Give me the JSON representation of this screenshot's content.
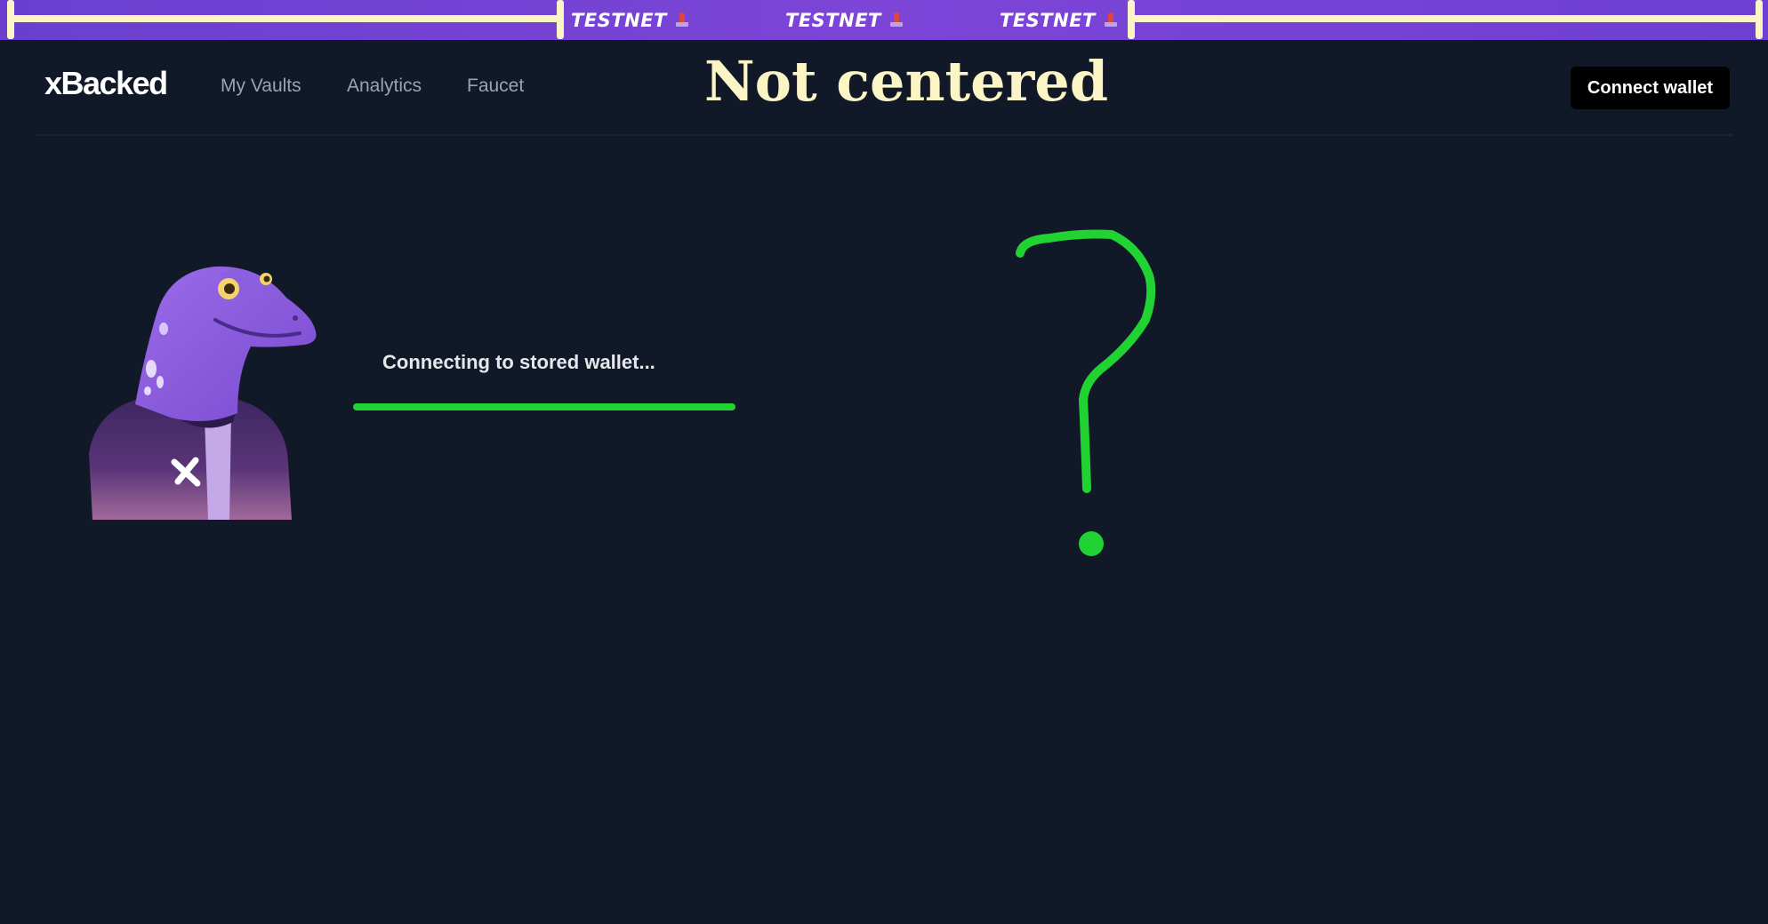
{
  "banner": {
    "items": [
      "TESTNET",
      "TESTNET",
      "TESTNET"
    ],
    "lamp_icon": "rotating-beacon-icon",
    "background": "#7441d5"
  },
  "header": {
    "logo": "xBacked",
    "nav": [
      "My Vaults",
      "Analytics",
      "Faucet"
    ],
    "connect_button": "Connect wallet"
  },
  "annotations": {
    "title": "Not centered",
    "title_color": "#fbf5c6",
    "marker_color": "#21d332"
  },
  "main": {
    "status": "Connecting to stored wallet...",
    "mascot_icon": "lizard-mascot-icon"
  },
  "colors": {
    "background": "#111827",
    "nav_text": "#9ca3af",
    "button_bg": "#000000"
  }
}
